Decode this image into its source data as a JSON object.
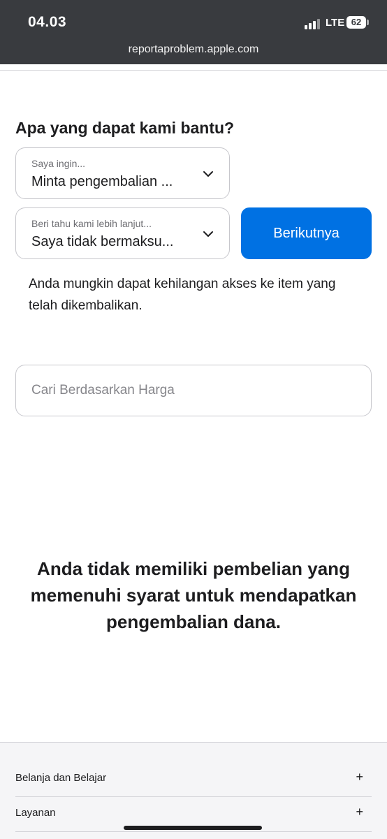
{
  "status_bar": {
    "time": "04.03",
    "network": "LTE",
    "battery": "62",
    "url": "reportaproblem.apple.com"
  },
  "main": {
    "title": "Apa yang dapat kami bantu?",
    "select_1": {
      "label": "Saya ingin...",
      "value": "Minta pengembalian ..."
    },
    "select_2": {
      "label": "Beri tahu kami lebih lanjut...",
      "value": "Saya tidak bermaksu..."
    },
    "next_button": "Berikutnya",
    "info_text": "Anda mungkin dapat kehilangan akses ke item yang telah dikembalikan.",
    "search": {
      "placeholder": "Cari Berdasarkan Harga"
    },
    "empty_message": "Anda tidak memiliki pembelian yang memenuhi syarat untuk mendapatkan pengembalian dana."
  },
  "footer": {
    "items": [
      {
        "label": "Belanja dan Belajar",
        "icon": "+"
      },
      {
        "label": "Layanan",
        "icon": "+"
      }
    ]
  },
  "colors": {
    "status_bar_bg": "#393b3f",
    "accent": "#0071e3",
    "footer_bg": "#f5f5f7"
  },
  "icons": [
    "chevron-down-icon",
    "plus-icon",
    "signal-icon",
    "battery-icon"
  ]
}
